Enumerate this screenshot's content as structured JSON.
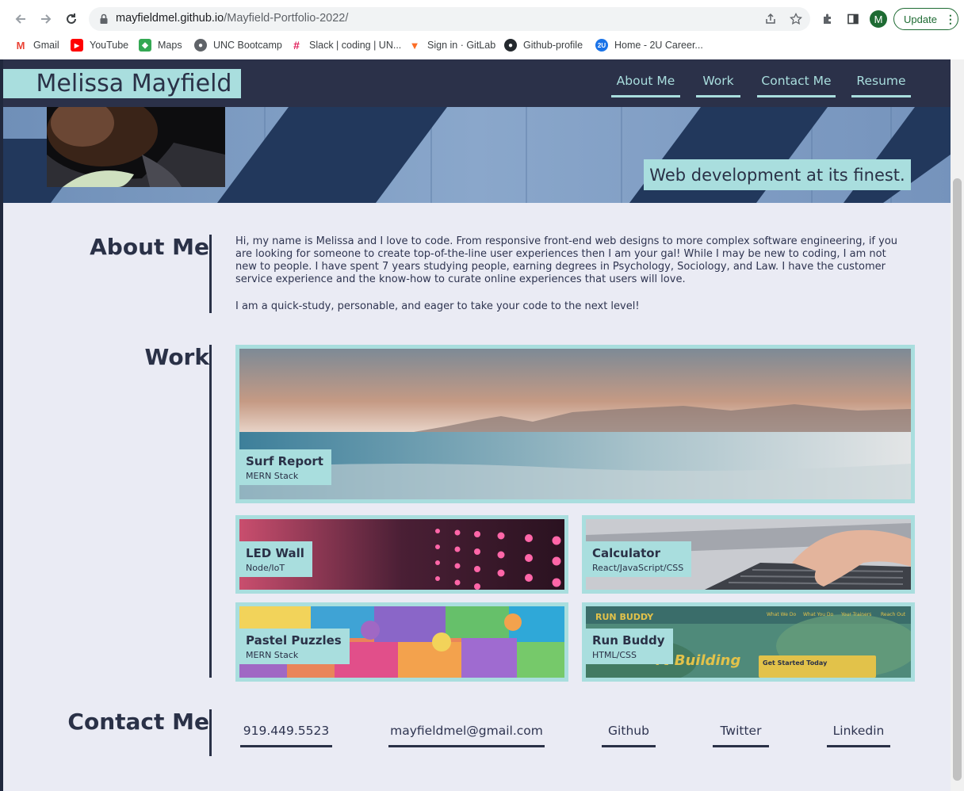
{
  "browser": {
    "url_host": "mayfieldmel.github.io",
    "url_path": "/Mayfield-Portfolio-2022/",
    "profile_initial": "M",
    "update_label": "Update",
    "bookmarks": [
      {
        "label": "Gmail",
        "color": "#ea4335"
      },
      {
        "label": "YouTube",
        "color": "#ff0000"
      },
      {
        "label": "Maps",
        "color": "#34a853"
      },
      {
        "label": "UNC Bootcamp",
        "color": "#5f6368"
      },
      {
        "label": "Slack | coding | UN...",
        "color": "#e01e5a"
      },
      {
        "label": "Sign in · GitLab",
        "color": "#fc6d26"
      },
      {
        "label": "Github-profile",
        "color": "#24292e"
      },
      {
        "label": "Home - 2U Career...",
        "color": "#1a73e8"
      }
    ]
  },
  "header": {
    "title": "Melissa Mayfield",
    "nav": [
      "About Me",
      "Work",
      "Contact Me",
      "Resume"
    ]
  },
  "hero": {
    "tagline": "Web development at its finest."
  },
  "about": {
    "heading": "About Me",
    "paragraphs": [
      "Hi, my name is Melissa and I love to code. From responsive front-end web designs to more complex software engineering, if you are looking for someone to create top-of-the-line user experiences then I am your gal! While I may be new to coding, I am not new to people. I have spent 7 years studying people, earning degrees in Psychology, Sociology, and Law. I have the customer service experience and the know-how to curate online experiences that users will love.",
      "I am a quick-study, personable, and eager to take your code to the next level!"
    ]
  },
  "work": {
    "heading": "Work",
    "projects": [
      {
        "name": "Surf Report",
        "tech": "MERN Stack"
      },
      {
        "name": "LED Wall",
        "tech": "Node/IoT"
      },
      {
        "name": "Calculator",
        "tech": "React/JavaScript/CSS"
      },
      {
        "name": "Pastel Puzzles",
        "tech": "MERN Stack"
      },
      {
        "name": "Run Buddy",
        "tech": "HTML/CSS"
      }
    ],
    "run_buddy_screenshot": {
      "brand": "RUN BUDDY",
      "nav": [
        "What We Do",
        "What You Do",
        "Your Trainers",
        "Reach Out"
      ],
      "headline": "rt Building",
      "cta_title": "Get Started Today"
    }
  },
  "contact": {
    "heading": "Contact Me",
    "links": [
      "919.449.5523",
      "mayfieldmel@gmail.com",
      "Github",
      "Twitter",
      "Linkedin"
    ]
  },
  "colors": {
    "accent": "#a9dede",
    "navy": "#2b3149",
    "page_bg": "#eaebf4",
    "text": "#2a3147"
  }
}
